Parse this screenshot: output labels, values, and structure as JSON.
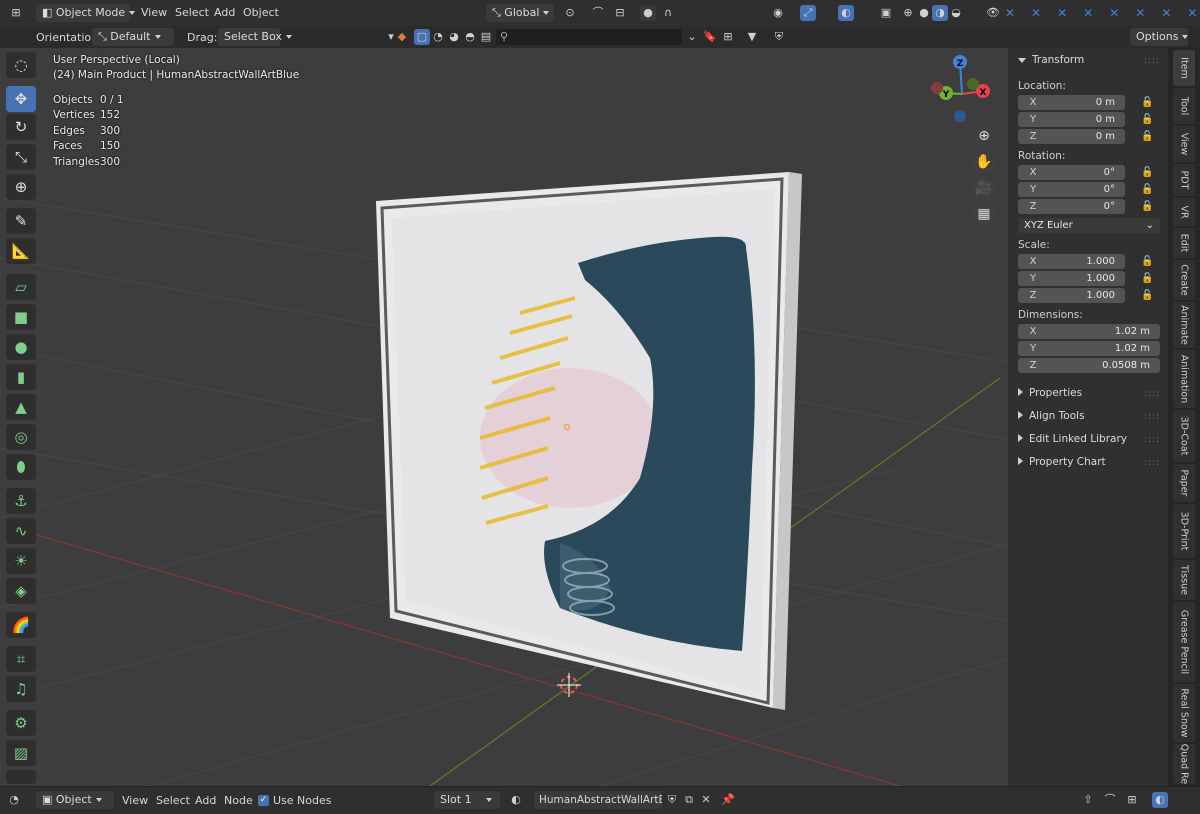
{
  "header": {
    "mode": "Object Mode",
    "menu": [
      "View",
      "Select",
      "Add",
      "Object"
    ],
    "transform_orientation": "Global"
  },
  "tool_settings": {
    "orientation_label": "Orientation:",
    "orientation_value": "Default",
    "drag_label": "Drag:",
    "drag_value": "Select Box",
    "options": "Options",
    "search_placeholder": ""
  },
  "overlay": {
    "view_name": "User Perspective (Local)",
    "collection_object": "(24) Main Product | HumanAbstractWallArtBlue",
    "stats": [
      {
        "label": "Objects",
        "value": "0 / 1"
      },
      {
        "label": "Vertices",
        "value": "152"
      },
      {
        "label": "Edges",
        "value": "300"
      },
      {
        "label": "Faces",
        "value": "150"
      },
      {
        "label": "Triangles",
        "value": "300"
      }
    ]
  },
  "gizmo": {
    "x": "X",
    "y": "Y",
    "z": "Z"
  },
  "transform_panel": {
    "title": "Transform",
    "location_label": "Location:",
    "location": [
      {
        "axis": "X",
        "value": "0 m"
      },
      {
        "axis": "Y",
        "value": "0 m"
      },
      {
        "axis": "Z",
        "value": "0 m"
      }
    ],
    "rotation_label": "Rotation:",
    "rotation": [
      {
        "axis": "X",
        "value": "0°"
      },
      {
        "axis": "Y",
        "value": "0°"
      },
      {
        "axis": "Z",
        "value": "0°"
      }
    ],
    "rotation_mode": "XYZ Euler",
    "scale_label": "Scale:",
    "scale": [
      {
        "axis": "X",
        "value": "1.000"
      },
      {
        "axis": "Y",
        "value": "1.000"
      },
      {
        "axis": "Z",
        "value": "1.000"
      }
    ],
    "dimensions_label": "Dimensions:",
    "dimensions": [
      {
        "axis": "X",
        "value": "1.02 m"
      },
      {
        "axis": "Y",
        "value": "1.02 m"
      },
      {
        "axis": "Z",
        "value": "0.0508 m"
      }
    ]
  },
  "collapsed_panels": [
    "Properties",
    "Align Tools",
    "Edit Linked Library",
    "Property Chart"
  ],
  "side_tabs": [
    "Item",
    "Tool",
    "View",
    "PDT",
    "VR",
    "Edit",
    "Create",
    "Animate",
    "Animation",
    "3D-Coat",
    "Paper",
    "3D-Print",
    "Tissue",
    "Grease Pencil",
    "Real Snow",
    "Quad Re"
  ],
  "footer": {
    "mode": "Object",
    "menu": [
      "View",
      "Select",
      "Add",
      "Node"
    ],
    "use_nodes": "Use Nodes",
    "slot": "Slot 1",
    "material": "HumanAbstractWallArtBlue"
  },
  "colors": {
    "accent": "#4772b3",
    "x_axis": "#e8414e",
    "y_axis": "#6fb52c",
    "z_axis": "#3f83d6"
  }
}
